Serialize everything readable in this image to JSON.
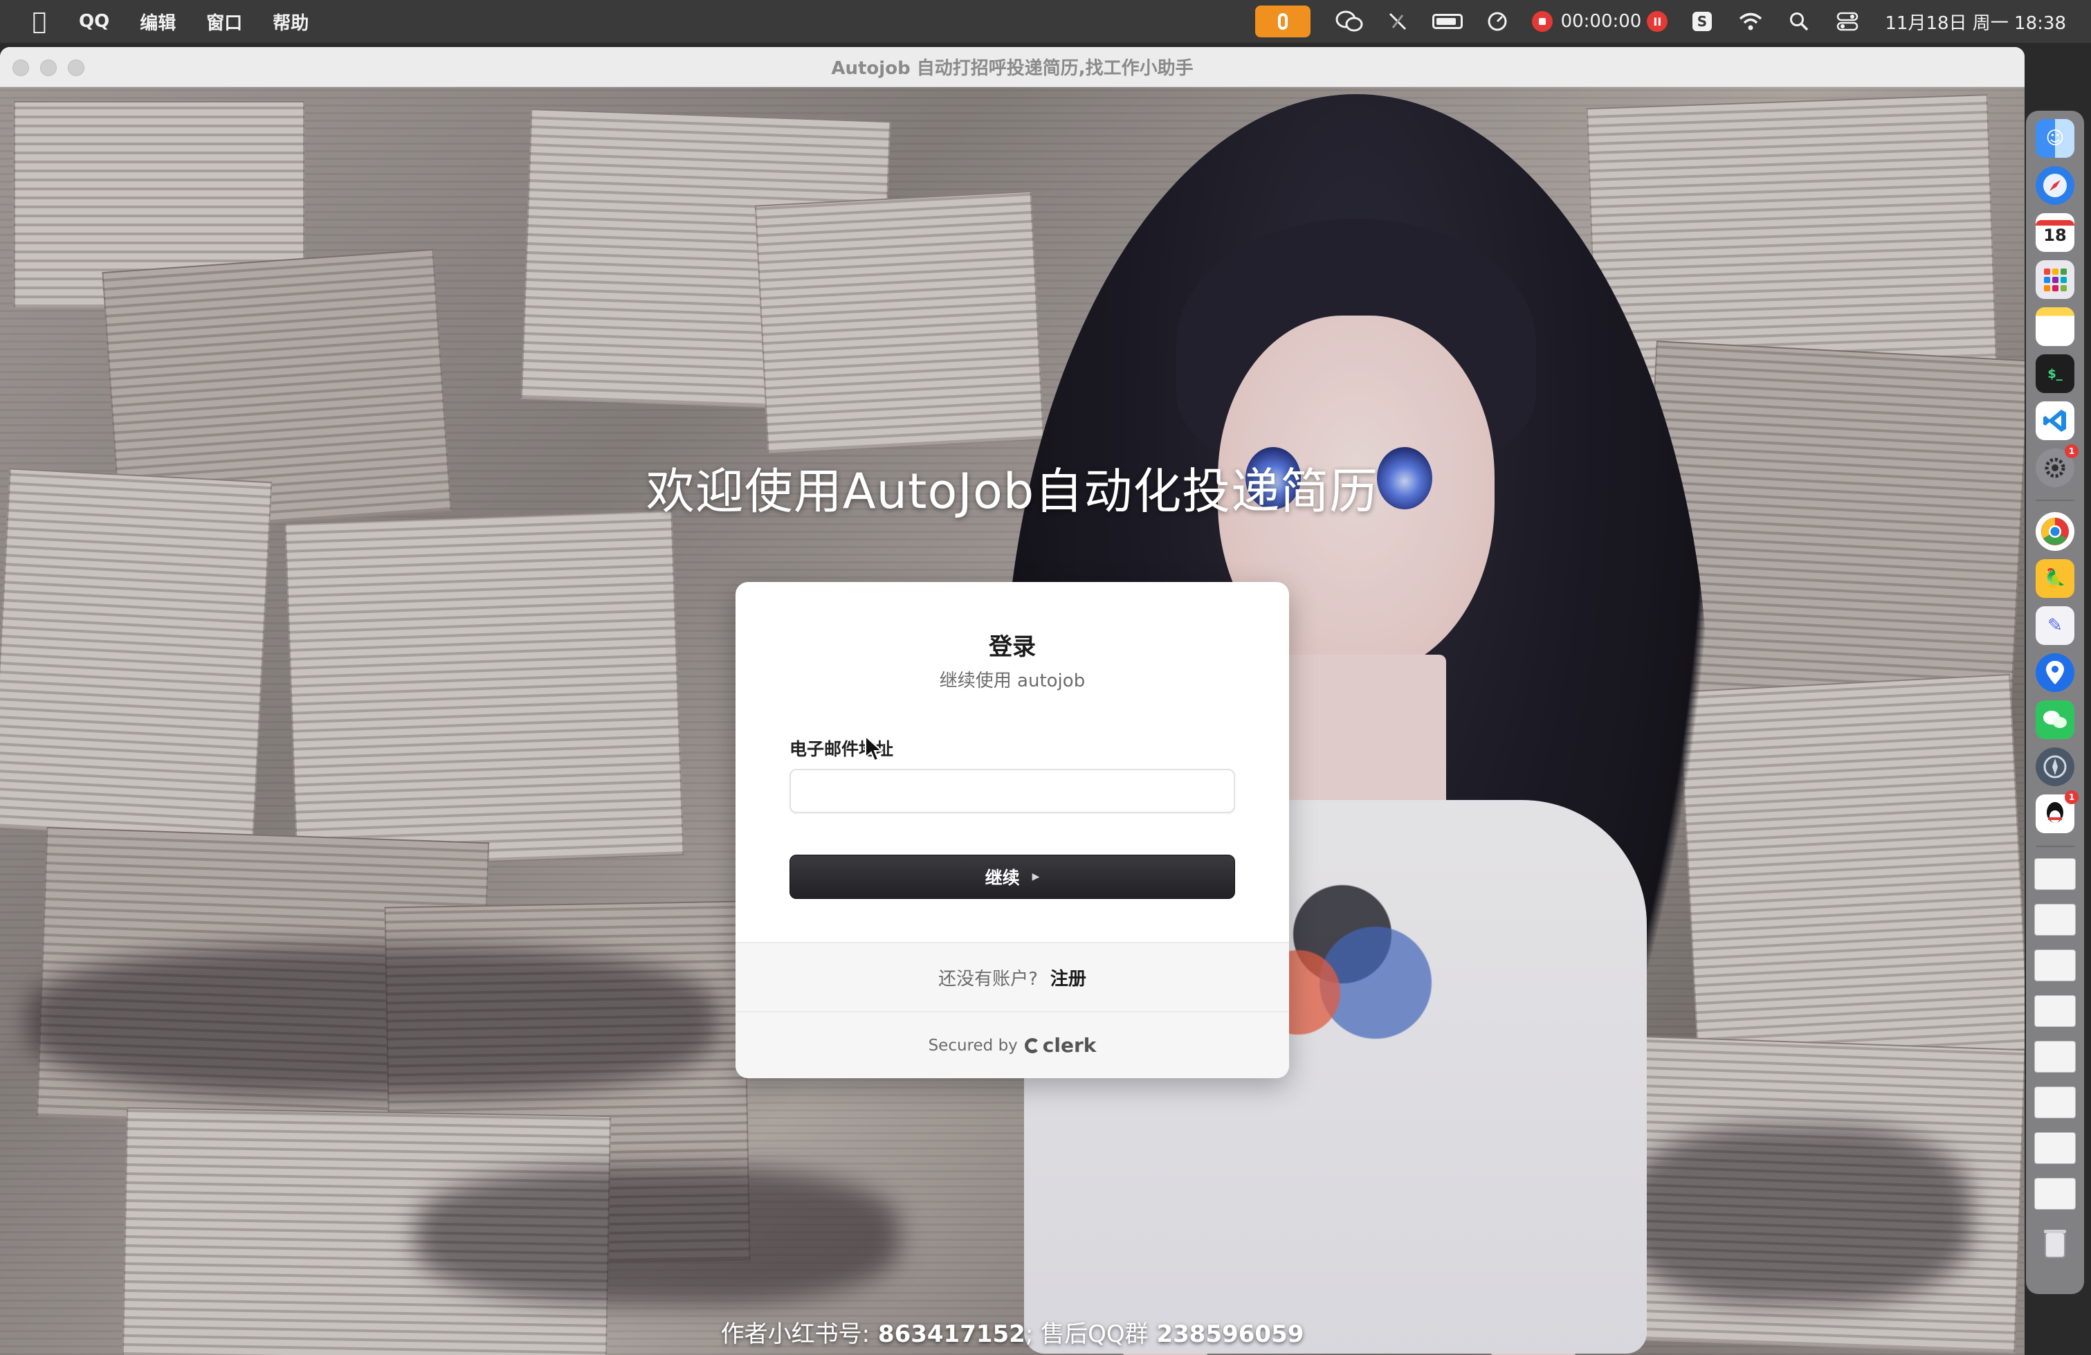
{
  "menubar": {
    "app_name": "QQ",
    "menus": [
      "编辑",
      "窗口",
      "帮助"
    ],
    "recording_time": "00:00:00",
    "datetime": "11月18日 周一 18:38",
    "icons": [
      "apple-logo-icon",
      "microphone-icon",
      "wechat-icon",
      "pen-slash-icon",
      "battery-icon",
      "stopwatch-icon",
      "record-icon",
      "pause-icon",
      "sougou-input-icon",
      "wifi-icon",
      "search-icon",
      "control-center-icon"
    ]
  },
  "window": {
    "title": "Autojob 自动打招呼投递简历,找工作小助手"
  },
  "page": {
    "headline": "欢迎使用AutoJob自动化投递简历",
    "footer_prefix": "作者小红书号:",
    "footer_xhs": "863417152",
    "footer_middle": "; 售后QQ群",
    "footer_qq": "238596059"
  },
  "login": {
    "title": "登录",
    "subtitle": "继续使用 autojob",
    "email_label": "电子邮件地址",
    "email_value": "",
    "continue_label": "继续",
    "signup_prompt": "还没有账户?",
    "signup_link": "注册",
    "secured_by": "Secured by",
    "clerk_brand": "clerk"
  },
  "dock": {
    "calendar_day": "18",
    "apps": [
      "finder",
      "safari",
      "calendar",
      "launchpad",
      "notes",
      "terminal",
      "vscode",
      "system-settings",
      "chrome",
      "parrot",
      "pinyin",
      "maps",
      "wechat",
      "compass",
      "qq"
    ]
  },
  "colors": {
    "mic_accent": "#f0901e",
    "record_red": "#e53935",
    "button_dark": "#27272a",
    "card_bg": "#ffffff"
  }
}
